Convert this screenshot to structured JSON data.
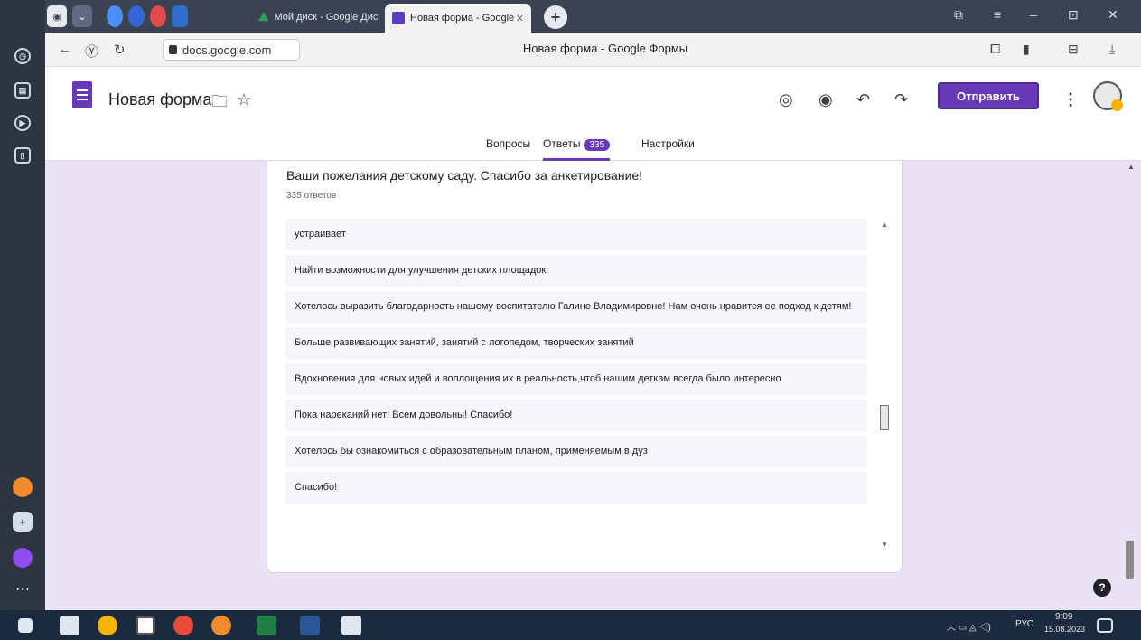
{
  "browser": {
    "tabs": [
      {
        "label": "Мой диск - Google Диск",
        "active": false
      },
      {
        "label": "Новая форма - Google",
        "active": true
      }
    ],
    "url": "docs.google.com",
    "page_title": "Новая форма - Google Формы"
  },
  "form": {
    "title": "Новая форма",
    "send_label": "Отправить",
    "tabs": {
      "questions": "Вопросы",
      "responses": "Ответы",
      "responses_count": "335",
      "settings": "Настройки"
    }
  },
  "question": {
    "title": "Ваши пожелания детскому саду. Спасибо за анкетирование!",
    "count_label": "335 ответов",
    "answers": [
      "устраивает",
      "Найти возможности для улучшения детских площадок.",
      "Хотелось выразить благодарность нашему воспитателю Галине Владимировне! Нам очень нравится ее подход к детям!",
      "Больше развивающих занятий, занятий с логопедом, творческих занятий",
      "Вдохновения для новых идей и воплощения их в реальность,чтоб нашим деткам всегда было интересно",
      "Пока нареканий нет! Всем довольны! Спасибо!",
      "Хотелось бы ознакомиться с образовательным планом, применяемым в дуз",
      "Спасибо!"
    ]
  },
  "taskbar": {
    "lang": "РУС",
    "time": "9:09",
    "date": "15.08.2023"
  },
  "colors": {
    "accent": "#673ab7",
    "page_bg": "#e9e3f5",
    "card_bg": "#ffffff"
  }
}
